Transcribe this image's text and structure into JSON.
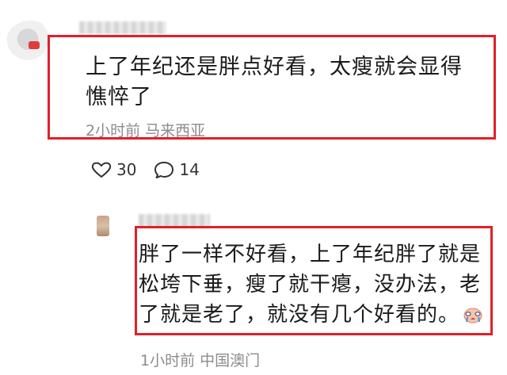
{
  "top_comment": {
    "text": "上了年纪还是胖点好看，太瘦就会显得憔悴了",
    "meta": "2小时前  马来西亚",
    "likes": "30",
    "replies": "14"
  },
  "reply": {
    "text": "胖了一样不好看，上了年纪胖了就是松垮下垂，瘦了就干瘪，没办法，老了就是老了，就没有几个好看的。",
    "emoji": "crying-face-emoji-icon",
    "meta": "1小时前  中国澳门"
  },
  "colors": {
    "highlight_border": "#e0202a",
    "meta_text": "#8c8c8c"
  }
}
